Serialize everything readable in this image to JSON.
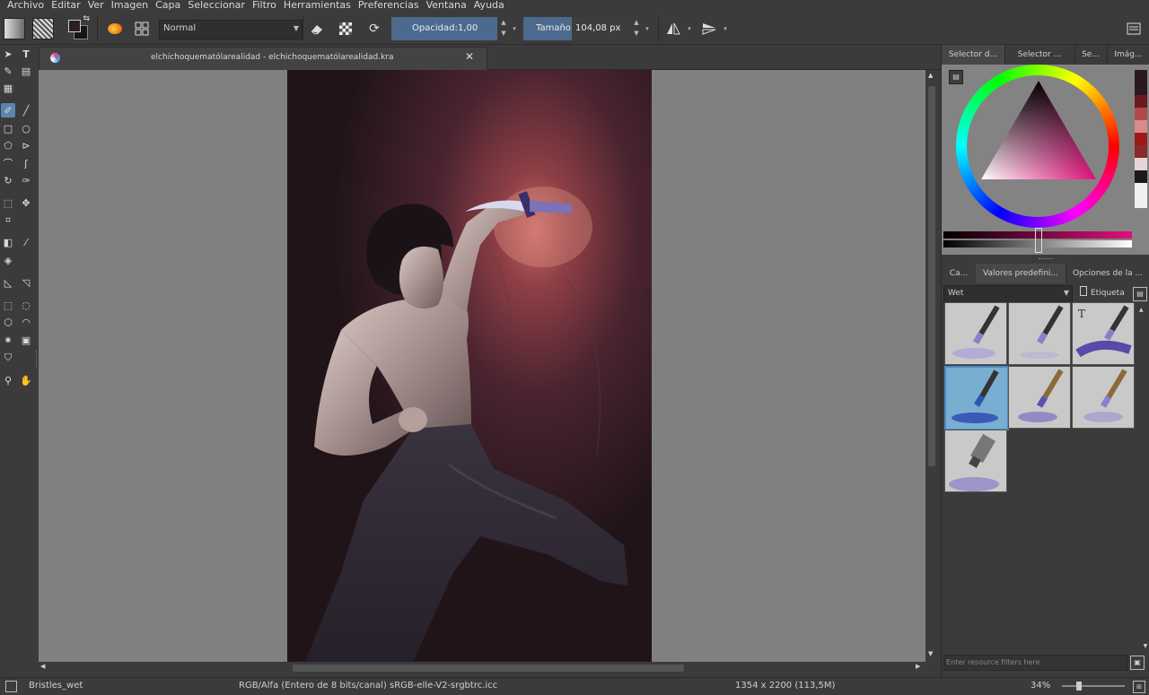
{
  "menu": [
    "Archivo",
    "Editar",
    "Ver",
    "Imagen",
    "Capa",
    "Seleccionar",
    "Filtro",
    "Herramientas",
    "Preferencias",
    "Ventana",
    "Ayuda"
  ],
  "toolbar": {
    "blend_mode": "Normal",
    "opacity_label": "Opacidad:",
    "opacity_value": "1,00",
    "size_label": "Tamaño:",
    "size_value": "104,08 px"
  },
  "document": {
    "tab_title": "elchichoquematólarealidad - elchichoquematólarealidad.kra"
  },
  "docker": {
    "top_tabs": [
      "Selector d...",
      "Selector ...",
      "Se...",
      "Imág..."
    ],
    "bottom_tabs": [
      "Ca...",
      "Valores predefini...",
      "Opciones de la ..."
    ],
    "preset_filter_value": "Wet",
    "tag_label": "Etiqueta",
    "resource_filter_placeholder": "Enter resource filters here"
  },
  "status": {
    "brush_name": "Bristles_wet",
    "color_model": "RGB/Alfa (Entero de 8 bits/canal)  sRGB-elle-V2-srgbtrc.icc",
    "dimensions": "1354 x 2200 (113,5M)",
    "zoom": "34%"
  },
  "colors": {
    "accent": "#4c6a8d",
    "chrome": "#3b3b3b",
    "canvas_bg": "#808080",
    "selected_preset": "#7aaed0"
  },
  "palette_swatches": [
    "#2a1a1f",
    "#6b1a20",
    "#b04a4a",
    "#d98a8a",
    "#a01818",
    "#8a2a2a",
    "#e6d5d8",
    "#1a1a1a",
    "#f0f0f0"
  ]
}
